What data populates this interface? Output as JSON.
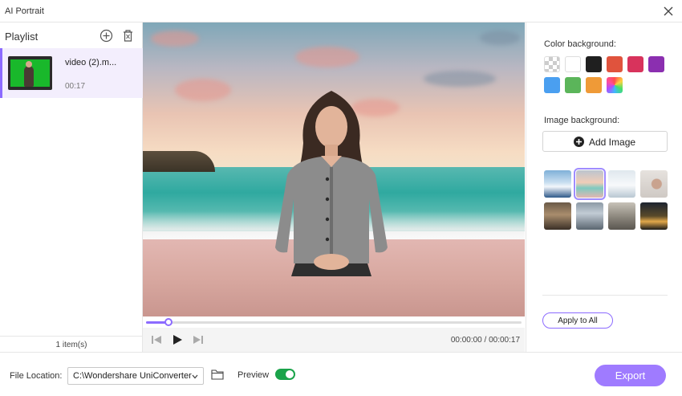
{
  "window": {
    "title": "AI Portrait"
  },
  "playlist": {
    "label": "Playlist",
    "items": [
      {
        "name": "video (2).m...",
        "duration": "00:17"
      }
    ],
    "count_text": "1 item(s)"
  },
  "player": {
    "timecode": "00:00:00 / 00:00:17",
    "progress_fraction": 0.06
  },
  "color_background": {
    "label": "Color background:",
    "swatches": [
      "transparent",
      "#ffffff",
      "#1f1f1f",
      "#e0533d",
      "#d8335c",
      "#8b2fb0",
      "#4a9ff0",
      "#5bb55a",
      "#ef9a37",
      "gradient"
    ]
  },
  "image_background": {
    "label": "Image background:",
    "add_label": "Add Image",
    "thumbnails": [
      "snowy-mountains",
      "beach-sunset",
      "winter-field",
      "minimal-room",
      "cafe-interior",
      "office-interior",
      "restaurant",
      "city-night"
    ],
    "selected_index": 1
  },
  "apply_label": "Apply to All",
  "bottom": {
    "file_location_label": "File Location:",
    "file_location_value": "C:\\Wondershare UniConverter",
    "preview_label": "Preview",
    "preview_on": true,
    "export_label": "Export"
  },
  "colors": {
    "accent": "#8c6bff",
    "toggle": "#1aa34a",
    "export": "#9f7bff"
  }
}
